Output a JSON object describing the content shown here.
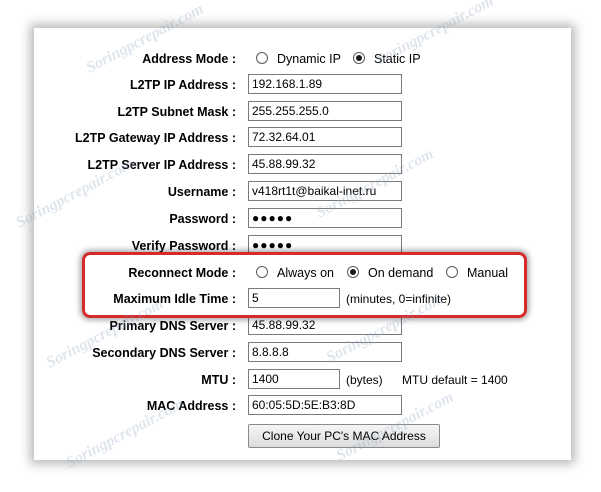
{
  "watermark": "Soringpcrepair.com",
  "address_mode": {
    "label": "Address Mode :",
    "options": [
      {
        "label": "Dynamic IP",
        "checked": false
      },
      {
        "label": "Static IP",
        "checked": true
      }
    ]
  },
  "fields": {
    "l2tp_ip": {
      "label": "L2TP IP Address :",
      "value": "192.168.1.89"
    },
    "l2tp_mask": {
      "label": "L2TP Subnet Mask :",
      "value": "255.255.255.0"
    },
    "l2tp_gateway": {
      "label": "L2TP Gateway IP Address :",
      "value": "72.32.64.01"
    },
    "l2tp_server": {
      "label": "L2TP Server IP Address :",
      "value": "45.88.99.32"
    },
    "username": {
      "label": "Username :",
      "value": "v418rt1t@baikal-inet.ru"
    },
    "password": {
      "label": "Password :",
      "value": "●●●●●"
    },
    "verify_password": {
      "label": "Verify Password :",
      "value": "●●●●●"
    },
    "primary_dns": {
      "label": "Primary DNS Server :",
      "value": "45.88.99.32"
    },
    "secondary_dns": {
      "label": "Secondary DNS Server :",
      "value": "8.8.8.8"
    },
    "mtu": {
      "label": "MTU :",
      "value": "1400",
      "unit": "(bytes)",
      "default_note": "MTU default = 1400"
    },
    "mac": {
      "label": "MAC Address :",
      "value": "60:05:5D:5E:B3:8D"
    }
  },
  "reconnect_mode": {
    "label": "Reconnect Mode :",
    "options": [
      {
        "label": "Always on",
        "checked": false
      },
      {
        "label": "On demand",
        "checked": true
      },
      {
        "label": "Manual",
        "checked": false
      }
    ]
  },
  "idle_time": {
    "label": "Maximum Idle Time :",
    "value": "5",
    "note": "(minutes, 0=infinite)"
  },
  "clone_button": "Clone Your PC's MAC Address",
  "colors": {
    "highlight": "#d62b2b"
  }
}
